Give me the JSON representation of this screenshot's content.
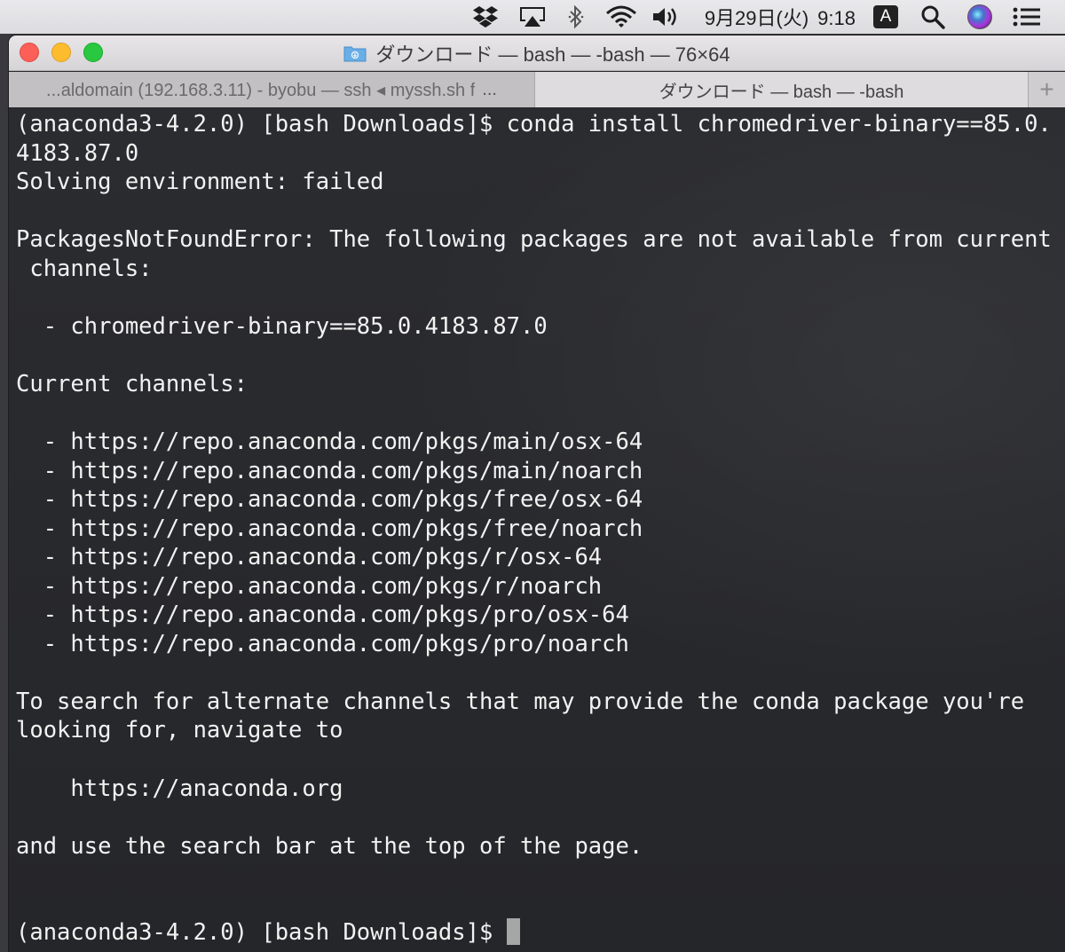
{
  "menubar": {
    "icons": [
      "dropbox-icon",
      "airplay-icon",
      "bluetooth-icon",
      "wifi-icon",
      "volume-icon",
      "input-source-icon",
      "spotlight-icon",
      "siri-icon",
      "notification-center-icon"
    ],
    "date": "9月29日(火)",
    "time": "9:18",
    "input_source": "A"
  },
  "window": {
    "title": "ダウンロード — bash — -bash — 76×64",
    "tabs": [
      {
        "label": "...aldomain (192.168.3.11) - byobu — ssh ◂ myssh.sh f",
        "active": false
      },
      {
        "label": "ダウンロード — bash — -bash",
        "active": true
      }
    ],
    "tab_overflow": "...",
    "add_tab": "+"
  },
  "terminal": {
    "lines": [
      "(anaconda3-4.2.0) [bash Downloads]$ conda install chromedriver-binary==85.0.",
      "4183.87.0",
      "Solving environment: failed",
      "",
      "PackagesNotFoundError: The following packages are not available from current",
      " channels:",
      "",
      "  - chromedriver-binary==85.0.4183.87.0",
      "",
      "Current channels:",
      "",
      "  - https://repo.anaconda.com/pkgs/main/osx-64",
      "  - https://repo.anaconda.com/pkgs/main/noarch",
      "  - https://repo.anaconda.com/pkgs/free/osx-64",
      "  - https://repo.anaconda.com/pkgs/free/noarch",
      "  - https://repo.anaconda.com/pkgs/r/osx-64",
      "  - https://repo.anaconda.com/pkgs/r/noarch",
      "  - https://repo.anaconda.com/pkgs/pro/osx-64",
      "  - https://repo.anaconda.com/pkgs/pro/noarch",
      "",
      "To search for alternate channels that may provide the conda package you're",
      "looking for, navigate to",
      "",
      "    https://anaconda.org",
      "",
      "and use the search bar at the top of the page.",
      "",
      "",
      "(anaconda3-4.2.0) [bash Downloads]$ "
    ]
  },
  "colors": {
    "terminal_bg": "#26272a",
    "terminal_fg": "#f2f2f2",
    "close": "#fc5f57",
    "minimize": "#fdbc2e",
    "maximize": "#29c840"
  }
}
